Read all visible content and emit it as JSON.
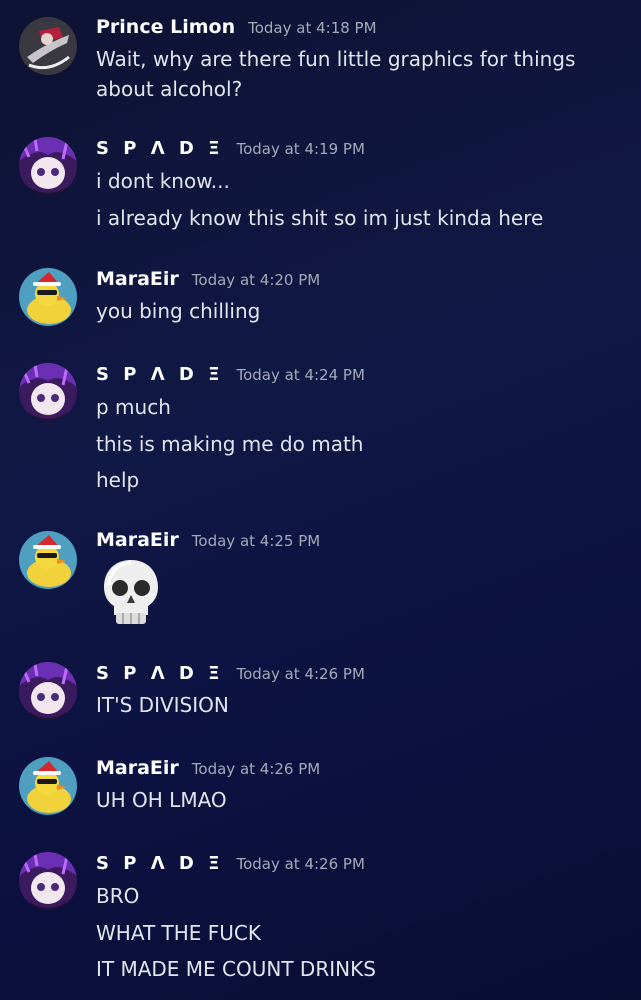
{
  "messages": [
    {
      "author": "Prince Limon",
      "time": "Today at 4:18 PM",
      "avatar": "prince-avatar",
      "lines": [
        "Wait, why are there fun little graphics for things about alcohol?"
      ]
    },
    {
      "author": "SPADE",
      "time": "Today at 4:19 PM",
      "avatar": "spade-avatar",
      "lines": [
        "i dont know...",
        "i already know this shit so im just kinda here"
      ]
    },
    {
      "author": "MaraEir",
      "time": "Today at 4:20 PM",
      "avatar": "duck-avatar",
      "lines": [
        "you bing chilling"
      ]
    },
    {
      "author": "SPADE",
      "time": "Today at 4:24 PM",
      "avatar": "spade-avatar",
      "lines": [
        "p much",
        "this is making me do math",
        "help"
      ]
    },
    {
      "author": "MaraEir",
      "time": "Today at 4:25 PM",
      "avatar": "duck-avatar",
      "emoji": "skull-emoji",
      "lines": []
    },
    {
      "author": "SPADE",
      "time": "Today at 4:26 PM",
      "avatar": "spade-avatar",
      "lines": [
        "IT'S DIVISION"
      ]
    },
    {
      "author": "MaraEir",
      "time": "Today at 4:26 PM",
      "avatar": "duck-avatar",
      "lines": [
        "UH OH LMAO"
      ]
    },
    {
      "author": "SPADE",
      "time": "Today at 4:26 PM",
      "avatar": "spade-avatar",
      "lines": [
        "BRO",
        "WHAT THE FUCK",
        "IT MADE ME COUNT DRINKS"
      ]
    }
  ],
  "spade_display_name": "S P Λ D Ξ",
  "colors": {
    "background": "#0e1438",
    "username": "#ffffff",
    "timestamp": "#a5a9b8",
    "text": "#e3e5ed"
  }
}
